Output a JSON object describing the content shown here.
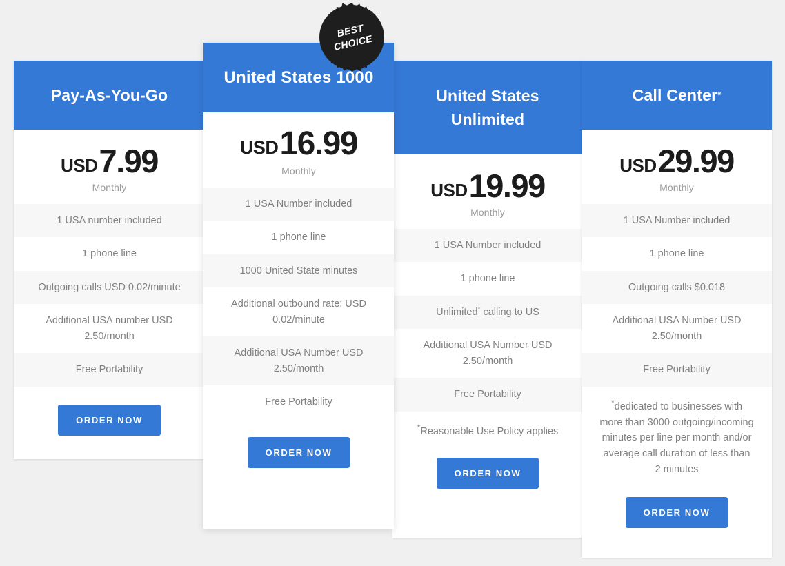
{
  "colors": {
    "accent_blue": "#3579d6",
    "badge_dark": "#1e1e1e",
    "page_background": "#f0f0f0",
    "row_alt_background": "#f7f7f7",
    "feature_text": "#80817f"
  },
  "badge": {
    "line1": "BEST",
    "line2": "CHOICE",
    "icon": "starburst-badge"
  },
  "plans": [
    {
      "id": "pay-as-you-go",
      "title": "Pay-As-You-Go",
      "title_suffix": "",
      "currency": "USD",
      "amount": "7.99",
      "period": "Monthly",
      "features": [
        "1 USA number included",
        "1 phone line",
        "Outgoing calls USD 0.02/minute",
        "Additional USA number USD 2.50/month",
        "Free Portability"
      ],
      "note": "",
      "cta": "ORDER NOW"
    },
    {
      "id": "united-states-1000",
      "title": "United States 1000",
      "title_suffix": "",
      "currency": "USD",
      "amount": "16.99",
      "period": "Monthly",
      "features": [
        "1 USA Number included",
        "1 phone line",
        "1000 United State minutes",
        "Additional outbound rate: USD 0.02/minute",
        "Additional USA Number USD 2.50/month",
        "Free Portability"
      ],
      "note": "",
      "cta": "ORDER NOW"
    },
    {
      "id": "united-states-unlimited",
      "title": "United States Unlimited",
      "title_suffix": "",
      "currency": "USD",
      "amount": "19.99",
      "period": "Monthly",
      "features": [
        "1 USA Number included",
        "1 phone line",
        "Unlimited* calling to US",
        "Additional USA Number USD 2.50/month",
        "Free Portability"
      ],
      "note": "*Reasonable Use Policy applies",
      "cta": "ORDER NOW"
    },
    {
      "id": "call-center",
      "title": "Call Center",
      "title_suffix": "*",
      "currency": "USD",
      "amount": "29.99",
      "period": "Monthly",
      "features": [
        "1 USA Number included",
        "1 phone line",
        "Outgoing calls $0.018",
        "Additional USA Number USD 2.50/month",
        "Free Portability"
      ],
      "note": "*dedicated to businesses with more than 3000 outgoing/incoming minutes per line per month and/or average call duration of less than 2 minutes",
      "cta": "ORDER NOW"
    }
  ]
}
